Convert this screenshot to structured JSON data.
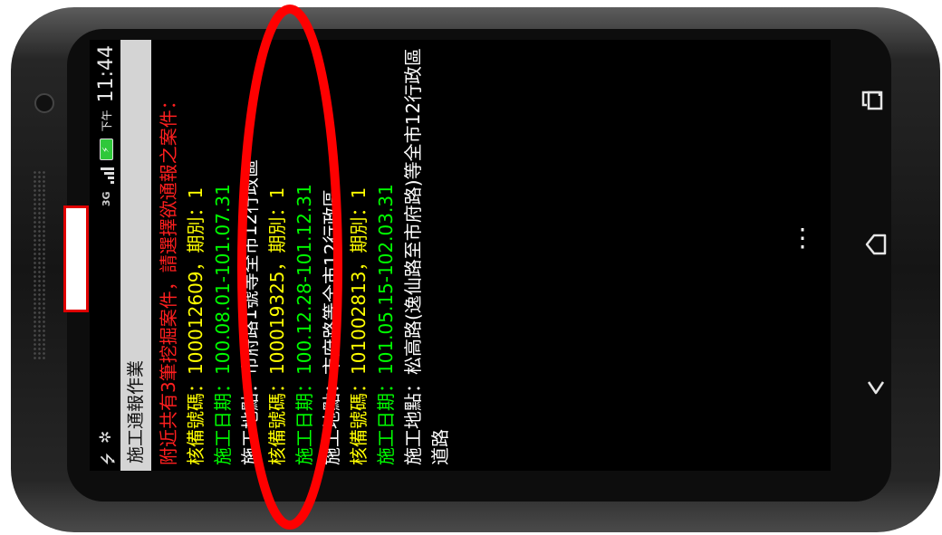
{
  "status_bar": {
    "left_icons": [
      "usb-icon",
      "android-debug-icon"
    ],
    "network": "3G",
    "battery_icon": "battery-charging-icon",
    "ampm": "下午",
    "time": "11:44"
  },
  "app": {
    "title": "施工通報作業"
  },
  "notice": "附近共有3筆挖掘案件，請選擇欲通報之案件：",
  "cases": [
    {
      "id_label": "核備號碼：",
      "id_value": "100012609，期別：1",
      "date_label": "施工日期：",
      "date_value": "100.08.01-101.07.31",
      "loc_label": "施工地點：",
      "loc_value": "市府路1號等全市12行政區"
    },
    {
      "id_label": "核備號碼：",
      "id_value": "100019325，期別：1",
      "date_label": "施工日期：",
      "date_value": "100.12.28-101.12.31",
      "loc_label": "施工地點：",
      "loc_value": "市府路等全市12行政區"
    },
    {
      "id_label": "核備號碼：",
      "id_value": "101002813，期別：1",
      "date_label": "施工日期：",
      "date_value": "101.05.15-102.03.31",
      "loc_label": "施工地點：",
      "loc_value": "松高路(逸仙路至市府路)等全市12行政區",
      "loc_value_cont": "道路"
    }
  ],
  "nav_keys": [
    "recent-apps-icon",
    "home-icon",
    "back-icon"
  ],
  "overflow_menu": "⋮",
  "colors": {
    "warning_text": "#ff1f1f",
    "id_label": "#ffff00",
    "date_label": "#00ff00",
    "annotation": "#ff0000"
  }
}
